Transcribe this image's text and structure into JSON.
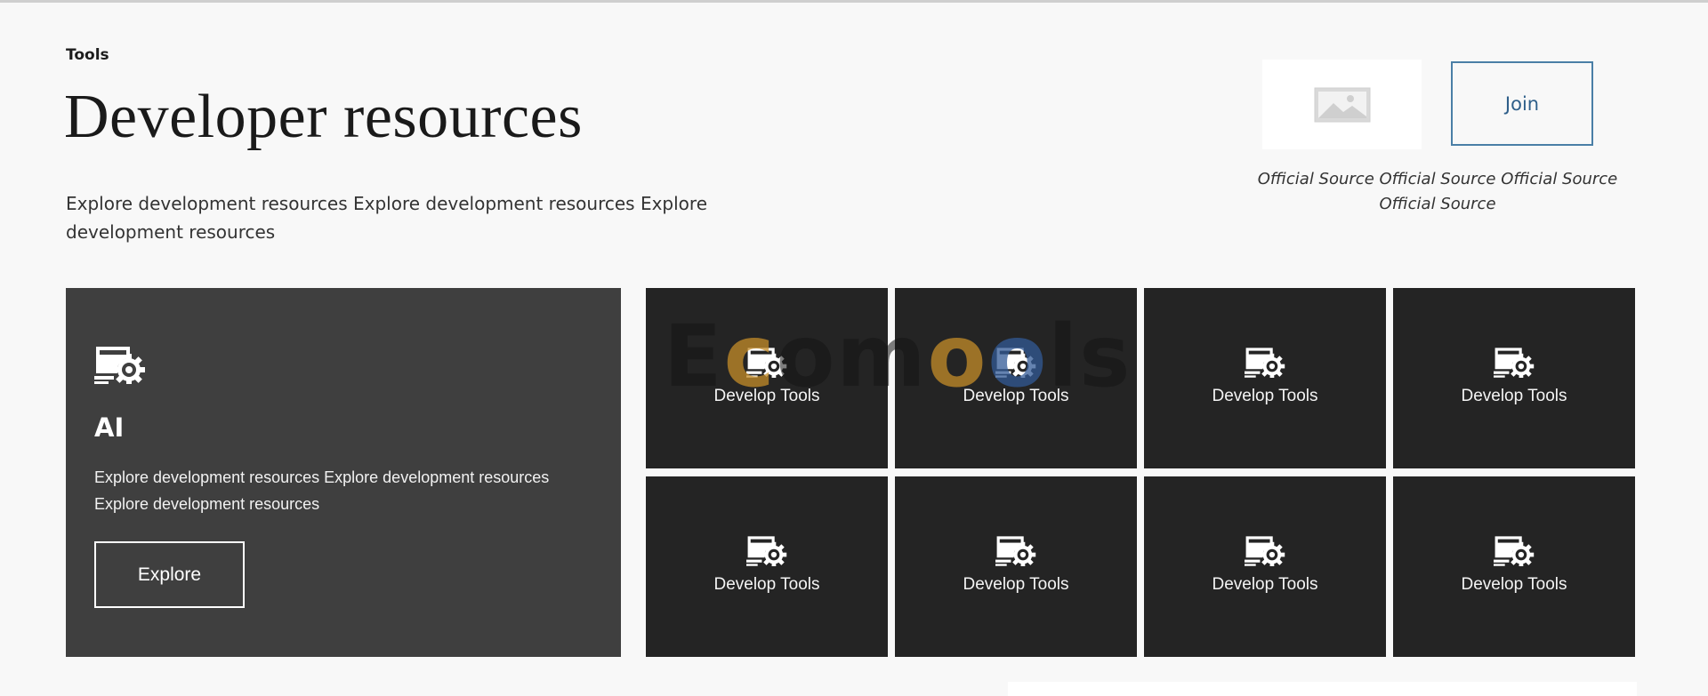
{
  "header": {
    "eyebrow": "Tools",
    "title": "Developer resources",
    "subtitle": "Explore development resources Explore development resources Explore development resources"
  },
  "aside": {
    "logo_icon": "image-placeholder-icon",
    "join_label": "Join",
    "source_text": "Official Source Official Source Official Source Official Source"
  },
  "feature": {
    "icon": "tools-gear-icon",
    "title": "AI",
    "description": "Explore development resources Explore development resources Explore development resources",
    "button_label": "Explore"
  },
  "tiles": [
    {
      "label": "Develop Tools",
      "icon": "tools-gear-icon"
    },
    {
      "label": "Develop Tools",
      "icon": "tools-gear-icon"
    },
    {
      "label": "Develop Tools",
      "icon": "tools-gear-icon"
    },
    {
      "label": "Develop Tools",
      "icon": "tools-gear-icon"
    },
    {
      "label": "Develop Tools",
      "icon": "tools-gear-icon"
    },
    {
      "label": "Develop Tools",
      "icon": "tools-gear-icon"
    },
    {
      "label": "Develop Tools",
      "icon": "tools-gear-icon"
    },
    {
      "label": "Develop Tools",
      "icon": "tools-gear-icon"
    }
  ],
  "watermark": {
    "text_a": "E",
    "text_b": "c",
    "text_c": "om",
    "text_d": "o",
    "text_e": "o",
    "text_f": "ls"
  },
  "colors": {
    "page_bg": "#f8f8f8",
    "feature_bg": "#3f3f3f",
    "tile_bg": "#242424",
    "join_border": "#4a7fa6"
  }
}
